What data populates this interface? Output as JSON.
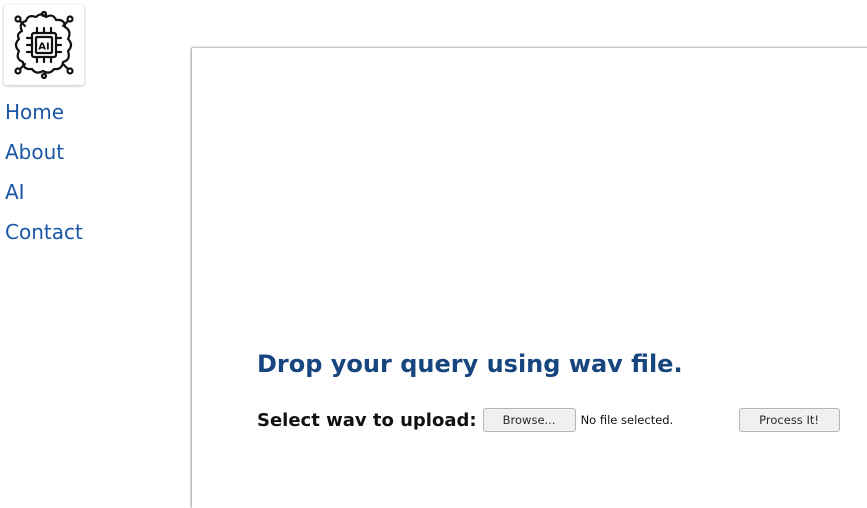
{
  "sidebar": {
    "logo": {
      "icon": "ai-chip-brain-icon",
      "text": "AI"
    },
    "nav": [
      {
        "label": "Home"
      },
      {
        "label": "About"
      },
      {
        "label": "AI"
      },
      {
        "label": "Contact"
      }
    ]
  },
  "main": {
    "heading": "Drop your query using wav file.",
    "upload": {
      "label": "Select wav to upload:",
      "browse_button": "Browse...",
      "file_status": "No file selected.",
      "process_button": "Process It!"
    }
  },
  "colors": {
    "nav_link": "#1a56a8",
    "heading": "#17457e"
  }
}
